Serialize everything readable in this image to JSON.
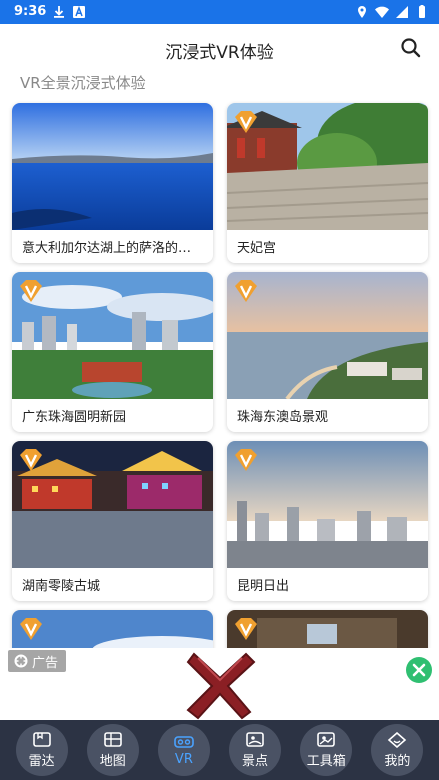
{
  "status_bar": {
    "time": "9:36",
    "icons": [
      "download-icon",
      "a-icon",
      "location-icon",
      "wifi-icon",
      "signal-icon",
      "battery-icon"
    ]
  },
  "header": {
    "title": "沉浸式VR体验",
    "search_icon": "search-icon"
  },
  "section_title": "VR全景沉浸式体验",
  "cards": [
    {
      "label": "意大利加尔达湖上的萨洛的…",
      "scene": "lake",
      "badge": false
    },
    {
      "label": "天妃宫",
      "scene": "temple",
      "badge": true
    },
    {
      "label": "广东珠海圆明新园",
      "scene": "city-park",
      "badge": true
    },
    {
      "label": "珠海东澳岛景观",
      "scene": "island",
      "badge": true
    },
    {
      "label": "湖南零陵古城",
      "scene": "night-town",
      "badge": true
    },
    {
      "label": "昆明日出",
      "scene": "sunrise-city",
      "badge": true
    },
    {
      "label": "",
      "scene": "sky",
      "badge": true
    },
    {
      "label": "",
      "scene": "building",
      "badge": true
    }
  ],
  "ad": {
    "tag_label": "广告",
    "close_icon": "close-circle-icon"
  },
  "bottom_nav": {
    "items": [
      {
        "label": "雷达",
        "icon": "radar-icon",
        "active": false
      },
      {
        "label": "地图",
        "icon": "map-icon",
        "active": false
      },
      {
        "label": "VR",
        "icon": "vr-goggles-icon",
        "active": true
      },
      {
        "label": "景点",
        "icon": "scenic-icon",
        "active": false
      },
      {
        "label": "工具箱",
        "icon": "toolbox-icon",
        "active": false
      },
      {
        "label": "我的",
        "icon": "profile-icon",
        "active": false
      }
    ]
  },
  "colors": {
    "status_bar": "#1a73e8",
    "nav_bg": "#2c3344",
    "nav_item_bg": "#4a5264",
    "active": "#4aa3ff",
    "ad_close": "#2fbf71",
    "ad_x": "#8b1f24",
    "badge": "#f0a030"
  }
}
